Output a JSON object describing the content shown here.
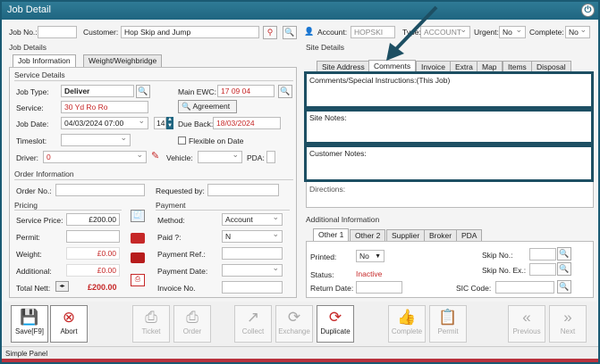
{
  "window": {
    "title": "Job Detail"
  },
  "header": {
    "job_no_label": "Job No.:",
    "customer_label": "Customer:",
    "customer_value": "Hop Skip and Jump",
    "account_label": "Account:",
    "account_value": "HOPSKI",
    "type_label": "Type:",
    "type_value": "ACCOUNT",
    "urgent_label": "Urgent:",
    "urgent_value": "No",
    "complete_label": "Complete:",
    "complete_value": "No"
  },
  "job_details": {
    "section_label": "Job Details",
    "tabs": [
      "Job Information",
      "Weight/Weighbridge"
    ],
    "service_details_label": "Service Details",
    "job_type_label": "Job Type:",
    "job_type_value": "Deliver",
    "main_ewc_label": "Main EWC:",
    "main_ewc_value": "17 09 04",
    "service_label": "Service:",
    "service_value": "30 Yd Ro Ro",
    "agreement_label": "Agreement",
    "job_date_label": "Job Date:",
    "job_date_value": "04/03/2024 07:00",
    "days_value": "14",
    "due_back_label": "Due Back:",
    "due_back_value": "18/03/2024",
    "timeslot_label": "Timeslot:",
    "flexible_label": "Flexible on Date",
    "driver_label": "Driver:",
    "driver_value": "0",
    "vehicle_label": "Vehicle:",
    "pda_label": "PDA:"
  },
  "order": {
    "section_label": "Order Information",
    "order_no_label": "Order No.:",
    "requested_by_label": "Requested by:"
  },
  "pricing": {
    "section_label": "Pricing",
    "service_price_label": "Service Price:",
    "service_price_value": "£200.00",
    "permit_label": "Permit:",
    "weight_label": "Weight:",
    "weight_value": "£0.00",
    "additional_label": "Additional:",
    "additional_value": "£0.00",
    "total_label": "Total Nett:",
    "total_value": "£200.00"
  },
  "payment": {
    "section_label": "Payment",
    "method_label": "Method:",
    "method_value": "Account",
    "paid_label": "Paid ?:",
    "paid_value": "N",
    "payment_ref_label": "Payment Ref.:",
    "payment_date_label": "Payment Date:",
    "invoice_label": "Invoice No."
  },
  "site_details": {
    "section_label": "Site Details",
    "tabs": [
      "Site Address",
      "Comments",
      "Invoice",
      "Extra",
      "Map",
      "Items",
      "Disposal"
    ],
    "comments_label": "Comments/Special Instructions:(This Job)",
    "site_notes_label": "Site Notes:",
    "customer_notes_label": "Customer Notes:",
    "directions_label": "Directions:"
  },
  "additional": {
    "section_label": "Additional Information",
    "tabs": [
      "Other 1",
      "Other 2",
      "Supplier",
      "Broker",
      "PDA"
    ],
    "printed_label": "Printed:",
    "printed_value": "No",
    "status_label": "Status:",
    "status_value": "Inactive",
    "return_date_label": "Return Date:",
    "skip_no_label": "Skip No.:",
    "skip_no_ex_label": "Skip No. Ex.:",
    "sic_code_label": "SIC Code:"
  },
  "toolbar": {
    "save": "Save[F9]",
    "abort": "Abort",
    "ticket": "Ticket",
    "order": "Order",
    "collect": "Collect",
    "exchange": "Exchange",
    "duplicate": "Duplicate",
    "complete": "Complete",
    "permit": "Permit",
    "previous": "Previous",
    "next": "Next"
  },
  "statusbar": {
    "text": "Simple Panel"
  },
  "colors": {
    "titlebar": "#1f6580",
    "highlight": "#1d4f63",
    "accent_red": "#c62828"
  }
}
